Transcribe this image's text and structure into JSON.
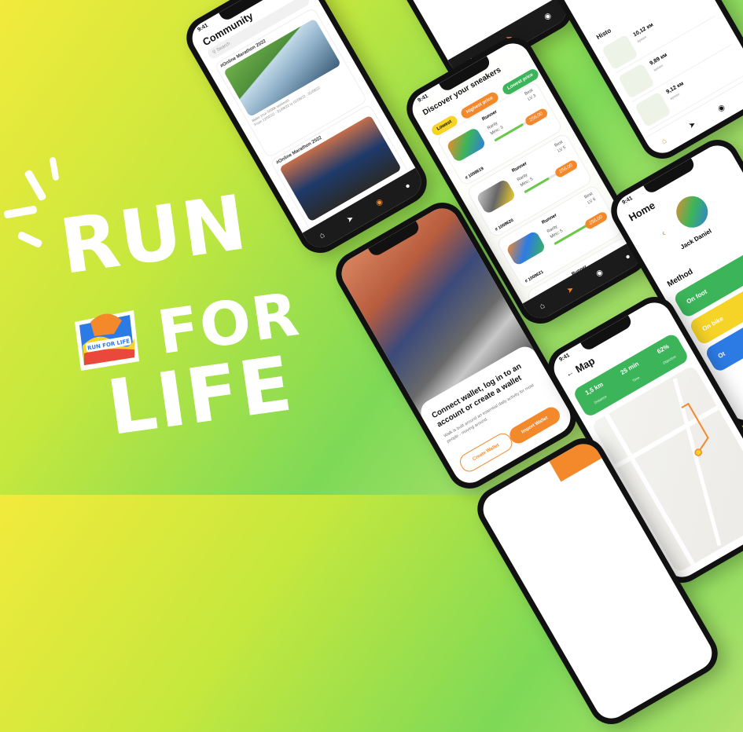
{
  "hero": {
    "line1": "RUN",
    "line2": "FOR",
    "line3": "LIFE",
    "badge_text": "RUN FOR LIFE"
  },
  "colors": {
    "accent": "#f4892c",
    "green": "#3cb55a",
    "yellow": "#f5d327",
    "dark": "#111111"
  },
  "community": {
    "time": "9:41",
    "title": "Community",
    "search_placeholder": "Search",
    "posts": [
      {
        "title": "#Online Marathon 2022",
        "meta1": "Make your 5000k workouts",
        "meta2": "From 12/02/22 - 31/08/22 to 01/08/22 - 31/08/22"
      },
      {
        "title": "#Online Marathon 2022"
      }
    ]
  },
  "discover": {
    "time": "9:41",
    "title": "Discover your sneakers",
    "filters": [
      "Lowest",
      "Highest price",
      "Lowest price"
    ],
    "cards": [
      {
        "name": "Runner",
        "rarity": "Rarity",
        "mint": "Minc: 3",
        "best": "Best",
        "lv": "LV 3",
        "price": "256,00",
        "id": "# 1008619"
      },
      {
        "name": "Runner",
        "rarity": "Rarity",
        "mint": "Minc: 5",
        "best": "Best",
        "lv": "LV 5",
        "price": "256,00",
        "id": "# 1008620"
      },
      {
        "name": "Runner",
        "rarity": "Rarity",
        "mint": "Minc: 5",
        "best": "Best",
        "lv": "LV 6",
        "price": "256,00",
        "id": "# 1008621"
      },
      {
        "name": "Runner"
      }
    ]
  },
  "wallet": {
    "title": "Connect wallet, log in to an account or create a wallet",
    "subtitle": "Walk is built around an essential daily activity for most people - moving around.",
    "create_label": "Create Wallet",
    "import_label": "Import Wallet"
  },
  "history": {
    "label": "Histo",
    "rows": [
      {
        "km": "10,12 км",
        "sub": "время"
      },
      {
        "km": "9,89 км",
        "sub": "время"
      },
      {
        "km": "9,12 км",
        "sub": "время"
      }
    ]
  },
  "home": {
    "time": "9:41",
    "title": "Home",
    "user": "Jack Daniel",
    "method_label": "Method",
    "methods": [
      "On foot",
      "On bike",
      "Ot"
    ]
  },
  "map": {
    "time": "9:41",
    "title": "Map",
    "stats": [
      {
        "value": "1,5 km",
        "label": "Distance"
      },
      {
        "value": "25 min",
        "label": "Time"
      },
      {
        "value": "62%",
        "label": "Objective"
      }
    ]
  }
}
